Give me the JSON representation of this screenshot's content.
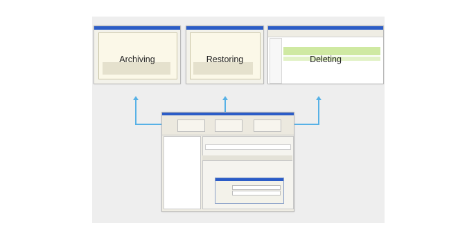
{
  "screens": [
    {
      "label": "Archiving"
    },
    {
      "label": "Restoring"
    },
    {
      "label": "Deleting"
    }
  ],
  "colors": {
    "panel": "#eeeeee",
    "connector": "#57b1e6",
    "window_titlebar": "#2b5cc7",
    "window_body": "#f3f2ea",
    "highlight_row": "#cfe9a2"
  }
}
